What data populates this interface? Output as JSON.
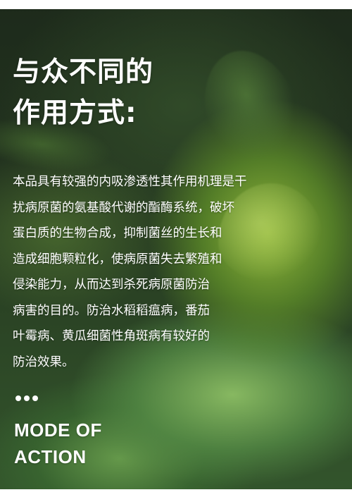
{
  "headline": {
    "line1": "与众不同的",
    "line2": "作用方式:"
  },
  "description": {
    "lines": [
      "本品具有较强的内吸渗透性其作用机理是干",
      "扰病原菌的氨基酸代谢的酯酶系统，破坏",
      "蛋白质的生物合成，抑制菌丝的生长和",
      "造成细胞颗粒化，使病原菌失去繁殖和",
      "侵染能力，从而达到杀死病原菌防治",
      "病害的目的。防治水稻稻瘟病，番茄",
      "叶霉病、黄瓜细菌性角斑病有较好的",
      "防治效果。"
    ]
  },
  "subtitle": {
    "line1": "MODE OF",
    "line2": "ACTION"
  },
  "colors": {
    "text": "#ffffff",
    "background_dark": "#1d2a1b",
    "tomato_green": "#96be3c",
    "leaf_green": "#8cbe64"
  }
}
